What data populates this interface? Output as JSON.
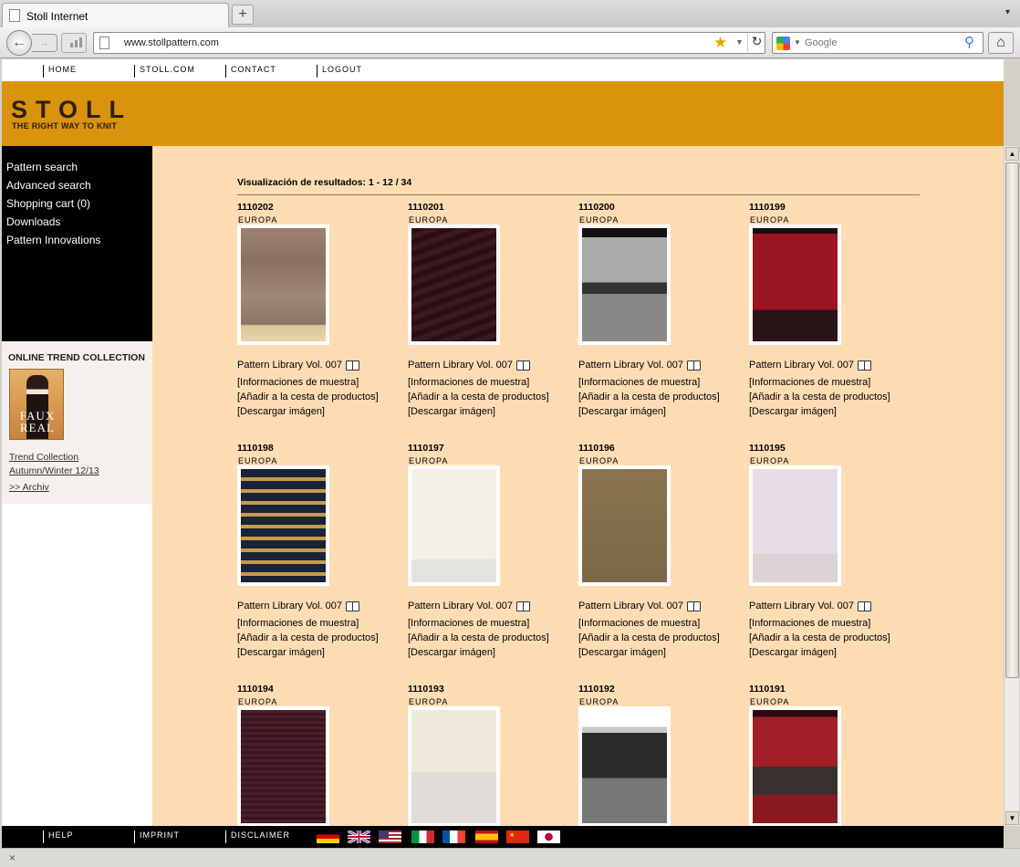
{
  "browser": {
    "tab_title": "Stoll Internet",
    "url": "www.stollpattern.com",
    "search_placeholder": "Google",
    "new_tab_label": "+",
    "tab_close": "×",
    "tab_menu": "▾",
    "status_close": "×"
  },
  "topnav": [
    "HOME",
    "STOLL.COM",
    "CONTACT",
    "LOGOUT"
  ],
  "brand": {
    "logo": "STOLL",
    "tagline": "THE RIGHT WAY TO KNIT"
  },
  "sidebar": {
    "items": [
      "Pattern search",
      "Advanced search",
      "Shopping cart (0)",
      "Downloads",
      "Pattern Innovations"
    ]
  },
  "trend": {
    "title": "ONLINE TREND COLLECTION",
    "image_text": "FAUX REAL",
    "link1_line1": "Trend Collection",
    "link1_line2": "Autumn/Winter 12/13",
    "link2": ">> Archiv"
  },
  "results": {
    "heading": "Visualización de resultados: 1 - 12 / 34",
    "link_info": "[Informaciones de muestra]",
    "link_cart": "[Añadir a la cesta de productos]",
    "link_download": "[Descargar imágen]",
    "items": [
      {
        "id": "1110202",
        "region": "EUROPA",
        "library": "Pattern Library Vol. 007",
        "swatch": "linear-gradient(#9b8272 0%,#8a7060 30%,#a08878 60%,#8c7565 85%,#d9c79a 86%,#e6d5a8 100%)"
      },
      {
        "id": "1110201",
        "region": "EUROPA",
        "library": "Pattern Library Vol. 007",
        "swatch": "repeating-linear-gradient(160deg,#2a0f12 0 6px,#3a1a1e 6px 12px)"
      },
      {
        "id": "1110200",
        "region": "EUROPA",
        "library": "Pattern Library Vol. 007",
        "swatch": "linear-gradient(#111 0 8%,#aaa 8% 48%,#333 48% 58%,#888 58% 100%)"
      },
      {
        "id": "1110199",
        "region": "EUROPA",
        "library": "Pattern Library Vol. 007",
        "swatch": "linear-gradient(#1a0c10 0 5%,#9a1422 5% 72%,#2a1418 72% 100%)"
      },
      {
        "id": "1110198",
        "region": "EUROPA",
        "library": "Pattern Library Vol. 007",
        "swatch": "repeating-linear-gradient(#1a2438 0 9px,#c99a4a 9px 13px)"
      },
      {
        "id": "1110197",
        "region": "EUROPA",
        "library": "Pattern Library Vol. 007",
        "swatch": "linear-gradient(#f2efe6 0 80%,#e4e4de 80% 100%)"
      },
      {
        "id": "1110196",
        "region": "EUROPA",
        "library": "Pattern Library Vol. 007",
        "swatch": "linear-gradient(#8a7450,#7c6846)"
      },
      {
        "id": "1110195",
        "region": "EUROPA",
        "library": "Pattern Library Vol. 007",
        "swatch": "linear-gradient(#e8dde4 0 75%,#ddd2d8 75% 100%)"
      },
      {
        "id": "1110194",
        "region": "EUROPA",
        "library": "",
        "swatch": "repeating-linear-gradient(#4a1e2a 0 3px,#3a1520 3px 6px)"
      },
      {
        "id": "1110193",
        "region": "EUROPA",
        "library": "",
        "swatch": "linear-gradient(#efe9dc 0 55%,#e0dcd8 55% 100%)"
      },
      {
        "id": "1110192",
        "region": "EUROPA",
        "library": "",
        "swatch": "linear-gradient(#fff 0 15%,#c8c8c8 15% 20%,#2a2a2a 20% 60%,#777 60% 100%)"
      },
      {
        "id": "1110191",
        "region": "EUROPA",
        "library": "",
        "swatch": "linear-gradient(#2a0a0e 0 6%,#a01e26 6% 50%,#3a3030 50% 75%,#8a1a20 75% 100%)"
      }
    ]
  },
  "footer": {
    "links": [
      "HELP",
      "IMPRINT",
      "DISCLAIMER"
    ],
    "flags": [
      {
        "name": "german-flag",
        "bg": "linear-gradient(#000 0 33%,#dd0000 33% 66%,#ffce00 66%)"
      },
      {
        "name": "uk-flag",
        "bg": "linear-gradient(#012169,#012169)"
      },
      {
        "name": "usa-flag",
        "bg": "repeating-linear-gradient(#b22234 0 2px,#fff 2px 4px)"
      },
      {
        "name": "italy-flag",
        "bg": "linear-gradient(90deg,#009246 0 33%,#fff 33% 66%,#ce2b37 66%)"
      },
      {
        "name": "france-flag",
        "bg": "linear-gradient(90deg,#0055a4 0 33%,#fff 33% 66%,#ef4135 66%)"
      },
      {
        "name": "spain-flag",
        "bg": "linear-gradient(#c60b1e 0 25%,#ffc400 25% 75%,#c60b1e 75%)"
      },
      {
        "name": "china-flag",
        "bg": "linear-gradient(#de2910,#de2910)"
      },
      {
        "name": "japan-flag",
        "bg": "radial-gradient(circle,#bc002d 0 4px,#fff 4.5px)"
      }
    ]
  }
}
